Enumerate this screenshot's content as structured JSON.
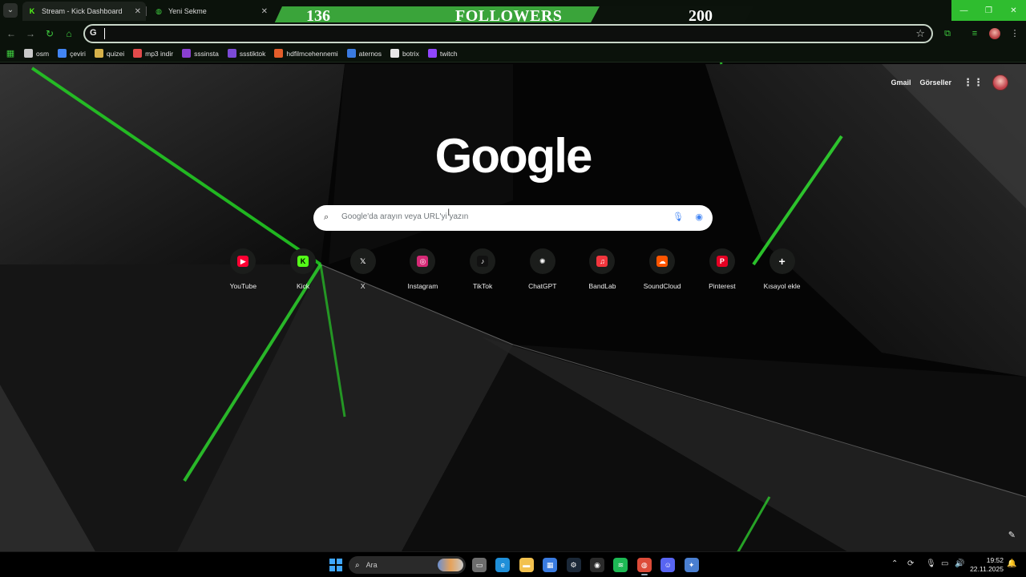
{
  "tabs": [
    {
      "title": "Stream - Kick Dashboard",
      "icon": "kick-icon",
      "active": true
    },
    {
      "title": "Yeni Sekme",
      "icon": "chrome-newtab-icon",
      "active": false
    }
  ],
  "followers_overlay": {
    "current": "136",
    "label": "FOLLOWERS",
    "goal": "200"
  },
  "window_controls": {
    "minimize": "—",
    "restore": "❐",
    "close": "✕"
  },
  "omnibox": {
    "value": ""
  },
  "bookmarks": [
    {
      "label": "osm",
      "icon": "osm-icon",
      "color": "#c9c9c9"
    },
    {
      "label": "çeviri",
      "icon": "translate-icon",
      "color": "#4285f4"
    },
    {
      "label": "quizei",
      "icon": "quizei-icon",
      "color": "#d6b24a"
    },
    {
      "label": "mp3 indir",
      "icon": "mp3-icon",
      "color": "#e34b4b"
    },
    {
      "label": "sssinsta",
      "icon": "sssinsta-icon",
      "color": "#8a3fd1"
    },
    {
      "label": "ssstiktok",
      "icon": "ssstiktok-icon",
      "color": "#7b4ad6"
    },
    {
      "label": "hdfilmcehennemi",
      "icon": "hdfilm-icon",
      "color": "#e35d2a"
    },
    {
      "label": "aternos",
      "icon": "aternos-icon",
      "color": "#3a7be0"
    },
    {
      "label": "botrix",
      "icon": "botrix-icon",
      "color": "#e8e8e8"
    },
    {
      "label": "twitch",
      "icon": "twitch-icon",
      "color": "#9146ff"
    }
  ],
  "header": {
    "gmail": "Gmail",
    "images": "Görseller"
  },
  "logo": "Google",
  "search": {
    "placeholder": "Google'da arayın veya URL'yi yazın"
  },
  "shortcuts": [
    {
      "label": "YouTube",
      "icon": "youtube-icon",
      "color": "#ff0033",
      "glyph": "▶"
    },
    {
      "label": "Kick",
      "icon": "kick-icon",
      "color": "#53fc18",
      "glyph": "K"
    },
    {
      "label": "X",
      "icon": "x-icon",
      "color": "#1b1d1b",
      "glyph": "𝕏"
    },
    {
      "label": "Instagram",
      "icon": "instagram-icon",
      "color": "#d62976",
      "glyph": "◎"
    },
    {
      "label": "TikTok",
      "icon": "tiktok-icon",
      "color": "#111111",
      "glyph": "♪"
    },
    {
      "label": "ChatGPT",
      "icon": "chatgpt-icon",
      "color": "#1b1d1b",
      "glyph": "✺"
    },
    {
      "label": "BandLab",
      "icon": "bandlab-icon",
      "color": "#f2363d",
      "glyph": "♫"
    },
    {
      "label": "SoundCloud",
      "icon": "soundcloud-icon",
      "color": "#ff5500",
      "glyph": "☁"
    },
    {
      "label": "Pinterest",
      "icon": "pinterest-icon",
      "color": "#e60023",
      "glyph": "P"
    },
    {
      "label": "Kısayol ekle",
      "icon": "add-shortcut-icon",
      "color": "#1b1d1b",
      "glyph": "+"
    }
  ],
  "taskbar": {
    "search_label": "Ara",
    "time": "19:52",
    "date": "22.11.2025",
    "apps": [
      {
        "name": "task-view-icon",
        "color": "#6d6d6d",
        "glyph": "▭"
      },
      {
        "name": "edge-icon",
        "color": "#1f8fd9",
        "glyph": "e"
      },
      {
        "name": "file-explorer-icon",
        "color": "#f2c14e",
        "glyph": "▬"
      },
      {
        "name": "store-icon",
        "color": "#3a7be0",
        "glyph": "▦"
      },
      {
        "name": "steam-icon",
        "color": "#1b2838",
        "glyph": "⚙"
      },
      {
        "name": "obs-icon",
        "color": "#2b2b2b",
        "glyph": "◉"
      },
      {
        "name": "spotify-icon",
        "color": "#1db954",
        "glyph": "≋"
      },
      {
        "name": "chrome-icon",
        "color": "#dd4b39",
        "glyph": "◍"
      },
      {
        "name": "discord-icon",
        "color": "#5865f2",
        "glyph": "☺"
      },
      {
        "name": "settings-app-icon",
        "color": "#4a7fd1",
        "glyph": "✦"
      }
    ]
  }
}
